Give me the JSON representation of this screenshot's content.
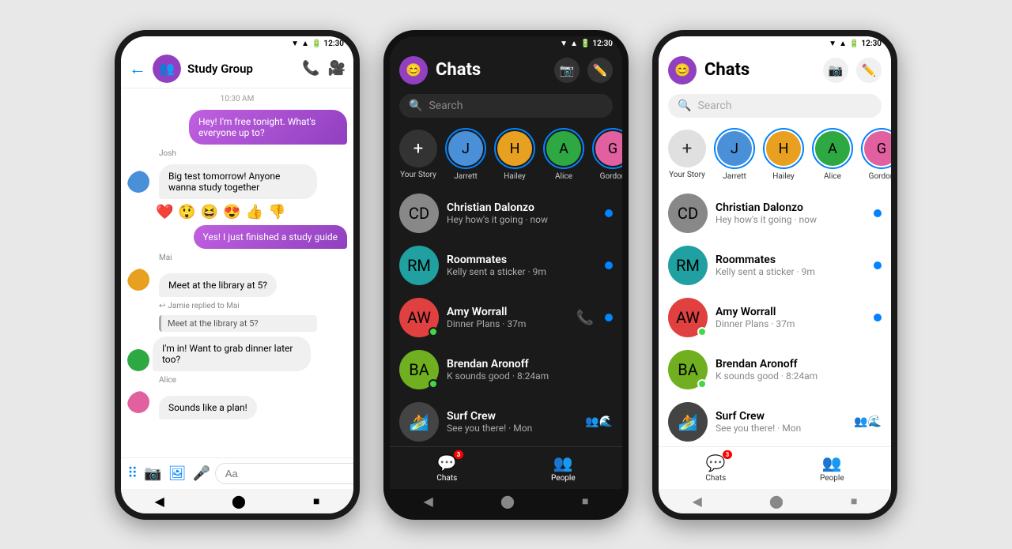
{
  "phone1": {
    "status_time": "12:30",
    "header": {
      "title": "Study Group",
      "back": "←",
      "phone_icon": "📞",
      "video_icon": "🎥"
    },
    "messages": [
      {
        "type": "timestamp",
        "text": "10:30 AM"
      },
      {
        "type": "right",
        "text": "Hey! I'm free tonight. What's everyone up to?"
      },
      {
        "type": "sender",
        "name": "Josh"
      },
      {
        "type": "left",
        "text": "Big test tomorrow! Anyone wanna study together"
      },
      {
        "type": "reactions",
        "emojis": [
          "❤️",
          "😲",
          "😆",
          "😍",
          "👍",
          "👎"
        ]
      },
      {
        "type": "right",
        "text": "Yes! I just finished a study guide"
      },
      {
        "type": "sender",
        "name": "Mai"
      },
      {
        "type": "left",
        "text": "Meet at the library at 5?"
      },
      {
        "type": "reply_context",
        "text": "Jamie replied to Mai"
      },
      {
        "type": "reply_bubble",
        "text": "Meet at the library at 5?"
      },
      {
        "type": "left",
        "text": "I'm in! Want to grab dinner later too?"
      },
      {
        "type": "sender",
        "name": "Alice"
      },
      {
        "type": "left",
        "text": "Sounds like a plan!"
      }
    ],
    "input_placeholder": "Aa"
  },
  "phone2": {
    "theme": "dark",
    "status_time": "12:30",
    "header": {
      "title": "Chats",
      "camera": "📷",
      "edit": "✏️"
    },
    "search_placeholder": "Search",
    "stories": [
      {
        "label": "Your Story",
        "type": "add"
      },
      {
        "label": "Jarrett",
        "color": "av-blue"
      },
      {
        "label": "Hailey",
        "color": "av-orange"
      },
      {
        "label": "Alice",
        "color": "av-green"
      },
      {
        "label": "Gordon",
        "color": "av-pink"
      }
    ],
    "chats": [
      {
        "name": "Christian Dalonzo",
        "preview": "Hey how's it going · now",
        "unread": true,
        "call": false,
        "online": false,
        "color": "av-gray"
      },
      {
        "name": "Roommates",
        "preview": "Kelly sent a sticker · 9m",
        "unread": true,
        "call": false,
        "online": false,
        "color": "av-teal"
      },
      {
        "name": "Amy Worrall",
        "preview": "Dinner Plans · 37m",
        "unread": true,
        "call": true,
        "online": true,
        "color": "av-red"
      },
      {
        "name": "Brendan Aronoff",
        "preview": "K sounds good · 8:24am",
        "unread": false,
        "call": false,
        "online": true,
        "color": "av-lime"
      },
      {
        "name": "Surf Crew",
        "preview": "See you there! · Mon",
        "unread": false,
        "call": false,
        "online": false,
        "color": "av-dark"
      }
    ],
    "tabs": [
      {
        "label": "Chats",
        "icon": "💬",
        "badge": "3",
        "active": true
      },
      {
        "label": "People",
        "icon": "👥",
        "badge": "",
        "active": false
      }
    ]
  },
  "phone3": {
    "theme": "light",
    "status_time": "12:30",
    "header": {
      "title": "Chats",
      "camera": "📷",
      "edit": "✏️"
    },
    "search_placeholder": "Search",
    "stories": [
      {
        "label": "Your Story",
        "type": "add"
      },
      {
        "label": "Jarrett",
        "color": "av-blue"
      },
      {
        "label": "Hailey",
        "color": "av-orange"
      },
      {
        "label": "Alice",
        "color": "av-green"
      },
      {
        "label": "Gordon",
        "color": "av-pink"
      }
    ],
    "chats": [
      {
        "name": "Christian Dalonzo",
        "preview": "Hey how's it going · now",
        "unread": true,
        "call": false,
        "online": false,
        "color": "av-gray"
      },
      {
        "name": "Roommates",
        "preview": "Kelly sent a sticker · 9m",
        "unread": true,
        "call": false,
        "online": false,
        "color": "av-teal"
      },
      {
        "name": "Amy Worrall",
        "preview": "Dinner Plans · 37m",
        "unread": true,
        "call": false,
        "online": true,
        "color": "av-red"
      },
      {
        "name": "Brendan Aronoff",
        "preview": "K sounds good · 8:24am",
        "unread": false,
        "call": false,
        "online": true,
        "color": "av-lime"
      },
      {
        "name": "Surf Crew",
        "preview": "See you there! · Mon",
        "unread": false,
        "call": false,
        "online": false,
        "color": "av-dark"
      }
    ],
    "tabs": [
      {
        "label": "Chats",
        "icon": "💬",
        "badge": "3",
        "active": true
      },
      {
        "label": "People",
        "icon": "👥",
        "badge": "",
        "active": false
      }
    ]
  }
}
